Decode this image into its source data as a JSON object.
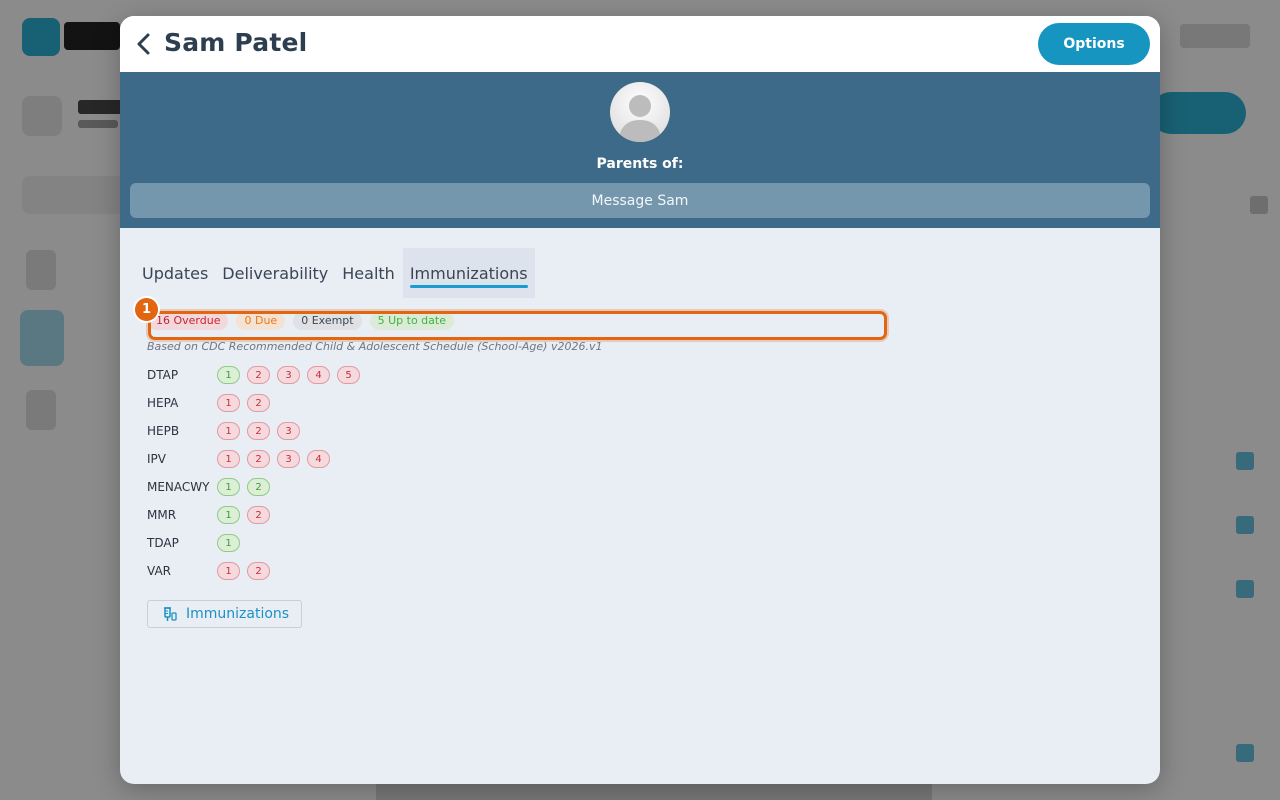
{
  "modal": {
    "title": "Sam Patel",
    "options_label": "Options",
    "parents_of": "Parents of:",
    "message_label": "Message Sam"
  },
  "tabs": [
    {
      "label": "Updates",
      "active": false
    },
    {
      "label": "Deliverability",
      "active": false
    },
    {
      "label": "Health",
      "active": false
    },
    {
      "label": "Immunizations",
      "active": true
    }
  ],
  "step_marker": "1",
  "summary": {
    "overdue": "16 Overdue",
    "due": "0 Due",
    "exempt": "0 Exempt",
    "uptodate": "5 Up to date"
  },
  "schedule_note": "Based on CDC Recommended Child & Adolescent Schedule (School-Age) v2026.v1",
  "vaccines": [
    {
      "name": "DTAP",
      "doses": [
        {
          "n": "1",
          "status": "ok"
        },
        {
          "n": "2",
          "status": "miss"
        },
        {
          "n": "3",
          "status": "miss"
        },
        {
          "n": "4",
          "status": "miss"
        },
        {
          "n": "5",
          "status": "miss"
        }
      ]
    },
    {
      "name": "HEPA",
      "doses": [
        {
          "n": "1",
          "status": "miss"
        },
        {
          "n": "2",
          "status": "miss"
        }
      ]
    },
    {
      "name": "HEPB",
      "doses": [
        {
          "n": "1",
          "status": "miss"
        },
        {
          "n": "2",
          "status": "miss"
        },
        {
          "n": "3",
          "status": "miss"
        }
      ]
    },
    {
      "name": "IPV",
      "doses": [
        {
          "n": "1",
          "status": "miss"
        },
        {
          "n": "2",
          "status": "miss"
        },
        {
          "n": "3",
          "status": "miss"
        },
        {
          "n": "4",
          "status": "miss"
        }
      ]
    },
    {
      "name": "MENACWY",
      "doses": [
        {
          "n": "1",
          "status": "ok"
        },
        {
          "n": "2",
          "status": "ok"
        }
      ]
    },
    {
      "name": "MMR",
      "doses": [
        {
          "n": "1",
          "status": "ok"
        },
        {
          "n": "2",
          "status": "miss"
        }
      ]
    },
    {
      "name": "TDAP",
      "doses": [
        {
          "n": "1",
          "status": "ok"
        }
      ]
    },
    {
      "name": "VAR",
      "doses": [
        {
          "n": "1",
          "status": "miss"
        },
        {
          "n": "2",
          "status": "miss"
        }
      ]
    }
  ],
  "immunizations_button": {
    "label": "Immunizations",
    "icon": "syringe-icon"
  },
  "colors": {
    "header_band": "#3e6a89",
    "accent": "#1795c1",
    "highlight": "#e2650f",
    "overdue": "#d0202e",
    "due": "#ec7a13",
    "uptodate": "#3fb43c"
  }
}
